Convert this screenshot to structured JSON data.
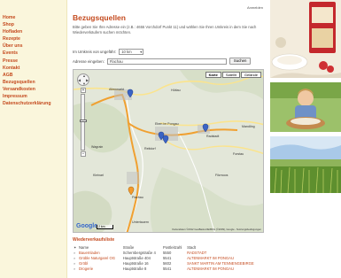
{
  "header": {
    "login_label": "Anmelden"
  },
  "sidebar": {
    "items": [
      {
        "label": "Home"
      },
      {
        "label": "Shop"
      },
      {
        "label": "Hofladen"
      },
      {
        "label": "Rezepte"
      },
      {
        "label": "Über uns"
      },
      {
        "label": "Events"
      },
      {
        "label": "Presse"
      },
      {
        "label": "Kontakt"
      },
      {
        "label": "AGB"
      },
      {
        "label": "Bezugsquellen"
      },
      {
        "label": "Versandkosten"
      },
      {
        "label": "Impressum"
      },
      {
        "label": "Datenschutzerklärung"
      }
    ]
  },
  "main": {
    "title": "Bezugsquellen",
    "intro": "Bitte geben Sie Ihre Adresse ein (z.B.: 4655 Vorchdorf Punkt 11) und wählen Sie Ihren Umkreis in dem Sie nach Wiederverkäufern suchen möchten.",
    "radius_label": "Im Umkreis von ungefähr:",
    "radius_value": "10 km",
    "address_label": "Adresse eingeben:",
    "address_value": "Flachau",
    "search_button": "Suchen"
  },
  "map": {
    "tabs": [
      "Karte",
      "Satellit",
      "Gelände"
    ],
    "active_tab": "Karte",
    "logo": "Google",
    "scale": "2 km",
    "copyright": "Kartendaten ©2012 GeoBasis-DE/BKG (©2009), Google - Nutzungsbedingungen",
    "places": [
      "Altenmarkt",
      "Radstadt",
      "Flachau",
      "Reitdorf",
      "Wagrain",
      "Filzmoos",
      "Eben im Pongau",
      "Forstau",
      "Untertauern",
      "Kleinarl",
      "Hüttau",
      "Mandling"
    ]
  },
  "dealers": {
    "heading": "Wiederverkaufsliste",
    "columns": [
      "Name",
      "Straße",
      "Postleitzahl",
      "Stadt"
    ],
    "rows": [
      {
        "name": "Bauernladen",
        "street": "Schernbergstraße 4",
        "zip": "5550",
        "city": "RADSTADT"
      },
      {
        "name": "Grüble Naturgarel OG",
        "street": "Hauptstraße 404",
        "zip": "5541",
        "city": "ALTENMARKT IM PONGAU"
      },
      {
        "name": "Gröbl",
        "street": "Hauptstraße 16",
        "zip": "5602",
        "city": "SANKT MARTIN AM TENNENGEBIRGE"
      },
      {
        "name": "Drogerie",
        "street": "Hauptstraße 8",
        "zip": "5541",
        "city": "ALTENMARKT IM PONGAU"
      }
    ]
  },
  "colors": {
    "accent": "#c44a1e",
    "sidebar_bg": "#faf6dc",
    "route": "#f0a030",
    "road": "#f6d36e"
  }
}
